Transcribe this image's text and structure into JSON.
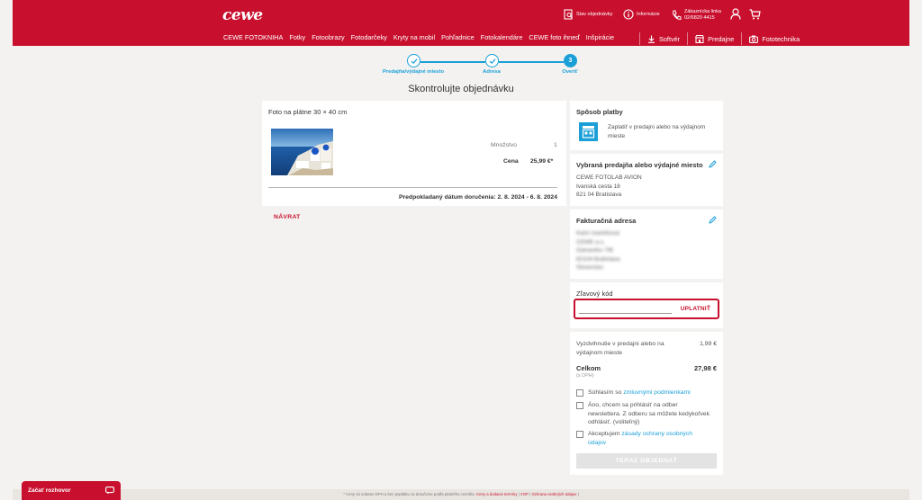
{
  "brand": {
    "logo": "cewe",
    "accent": "#c8102e",
    "link_color": "#1a9fd8"
  },
  "header": {
    "utilities": {
      "order_status": "Stav objednávky",
      "info": "Informácie",
      "phone_label": "Zákaznícka linka",
      "phone_number": "02/6820 4415"
    },
    "nav": [
      "CEWE FOTOKNIHA",
      "Fotky",
      "Fotoobrazy",
      "Fotodarčeky",
      "Kryty na mobil",
      "Pohľadnice",
      "Fotokalendáre",
      "CEWE foto ihneď",
      "Inšpirácie"
    ],
    "nav_right": {
      "software": "Softvér",
      "stores": "Predajne",
      "phototech": "Fototechnika"
    }
  },
  "stepper": {
    "steps": [
      {
        "label": "Predajňa/výdajné miesto",
        "state": "done"
      },
      {
        "label": "Adresa",
        "state": "done"
      },
      {
        "label": "Overiť",
        "number": "3",
        "state": "active"
      }
    ]
  },
  "page_title": "Skontrolujte objednávku",
  "product": {
    "title": "Foto na plátne 30 × 40 cm",
    "quantity_label": "Množstvo",
    "quantity": "1",
    "price_label": "Cena",
    "price": "25,99 €*",
    "delivery": "Predpokladaný dátum doručenia:  2. 8. 2024 - 6. 8. 2024"
  },
  "back_label": "NÁVRAT",
  "payment": {
    "title": "Spôsob platby",
    "line1": "Zaplatiť v predajni alebo na výdajnom",
    "line2": "mieste"
  },
  "store": {
    "title": "Vybraná predajňa alebo výdajné miesto",
    "name": "CEWE FOTOLAB AVION",
    "street": "Ivanská cesta 18",
    "city": "821 04 Bratislava"
  },
  "billing": {
    "title": "Fakturačná adresa",
    "lines": [
      "Karin Ivaničková",
      "CEWE a.s.",
      "Galvaniho 7/B",
      "82104 Bratislava",
      "Slovensko"
    ]
  },
  "coupon": {
    "title": "Zľavový kód",
    "value": "",
    "apply_label": "UPLATNIŤ"
  },
  "summary": {
    "pickup_line1": "Vyzdvihnutie v predajni alebo na",
    "pickup_line2": "výdajnom mieste",
    "pickup_price": "1,99 €",
    "total_label": "Celkom",
    "total_sub": "(s DPH)",
    "total_price": "27,98 €"
  },
  "consents": {
    "terms_prefix": "Súhlasím so ",
    "terms_link": "zmluvnými podmienkami",
    "newsletter_1": "Áno, chcem sa prihlásiť na odber",
    "newsletter_2": "newslettera. Z odberu sa môžete kedykoľvek",
    "newsletter_3": "odhlásiť. (voliteľný)",
    "privacy_prefix": "Akceptujem ",
    "privacy_link_1": "zásady ochrany osobných",
    "privacy_link_2": "údajov"
  },
  "order_button": "TERAZ OBJEDNAŤ",
  "footer": {
    "text": "* Ceny sú vrátane DPH a bez poplatku za doručenie podľa platného cenníka.",
    "link1": "Ceny a dodacie termíny",
    "link2": "VOP",
    "link3": "Ochrana osobných údajov"
  },
  "chat": {
    "label": "Začať rozhovor"
  }
}
